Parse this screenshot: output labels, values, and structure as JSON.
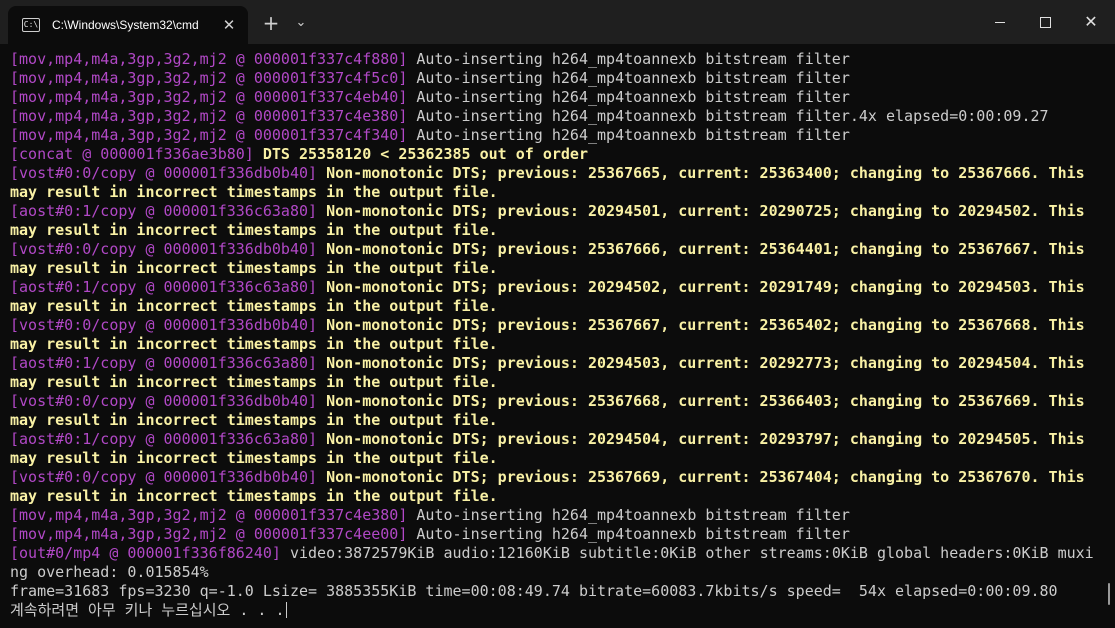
{
  "window": {
    "tab_title": "C:\\Windows\\System32\\cmd",
    "tab_icon_glyph": "C:\\",
    "close_tab_glyph": "✕",
    "new_tab_glyph": "+",
    "dropdown_glyph": "⌄",
    "close_window_glyph": "✕"
  },
  "colors": {
    "background": "#0c0c0c",
    "titlebar": "#1f1f1f",
    "default_text": "#cccccc",
    "log_prefix": "#b148c6",
    "warning_text": "#f9f1a5"
  },
  "terminal": {
    "lines": [
      {
        "prefix": "[mov,mp4,m4a,3gp,3g2,mj2 @ 000001f337c4f880]",
        "text": " Auto-inserting h264_mp4toannexb bitstream filter",
        "style": "gray"
      },
      {
        "prefix": "[mov,mp4,m4a,3gp,3g2,mj2 @ 000001f337c4f5c0]",
        "text": " Auto-inserting h264_mp4toannexb bitstream filter",
        "style": "gray"
      },
      {
        "prefix": "[mov,mp4,m4a,3gp,3g2,mj2 @ 000001f337c4eb40]",
        "text": " Auto-inserting h264_mp4toannexb bitstream filter",
        "style": "gray"
      },
      {
        "prefix": "[mov,mp4,m4a,3gp,3g2,mj2 @ 000001f337c4e380]",
        "text": " Auto-inserting h264_mp4toannexb bitstream filter.4x elapsed=0:00:09.27",
        "style": "gray"
      },
      {
        "prefix": "[mov,mp4,m4a,3gp,3g2,mj2 @ 000001f337c4f340]",
        "text": " Auto-inserting h264_mp4toannexb bitstream filter",
        "style": "gray"
      },
      {
        "prefix": "[concat @ 000001f336ae3b80]",
        "text": " DTS 25358120 < 25362385 out of order",
        "style": "yellow"
      },
      {
        "prefix": "[vost#0:0/copy @ 000001f336db0b40]",
        "text": " Non-monotonic DTS; previous: 25367665, current: 25363400; changing to 25367666. This",
        "style": "yellow"
      },
      {
        "prefix": "",
        "text": "may result in incorrect timestamps in the output file.",
        "style": "yellow"
      },
      {
        "prefix": "[aost#0:1/copy @ 000001f336c63a80]",
        "text": " Non-monotonic DTS; previous: 20294501, current: 20290725; changing to 20294502. This",
        "style": "yellow"
      },
      {
        "prefix": "",
        "text": "may result in incorrect timestamps in the output file.",
        "style": "yellow"
      },
      {
        "prefix": "[vost#0:0/copy @ 000001f336db0b40]",
        "text": " Non-monotonic DTS; previous: 25367666, current: 25364401; changing to 25367667. This",
        "style": "yellow"
      },
      {
        "prefix": "",
        "text": "may result in incorrect timestamps in the output file.",
        "style": "yellow"
      },
      {
        "prefix": "[aost#0:1/copy @ 000001f336c63a80]",
        "text": " Non-monotonic DTS; previous: 20294502, current: 20291749; changing to 20294503. This",
        "style": "yellow"
      },
      {
        "prefix": "",
        "text": "may result in incorrect timestamps in the output file.",
        "style": "yellow"
      },
      {
        "prefix": "[vost#0:0/copy @ 000001f336db0b40]",
        "text": " Non-monotonic DTS; previous: 25367667, current: 25365402; changing to 25367668. This",
        "style": "yellow"
      },
      {
        "prefix": "",
        "text": "may result in incorrect timestamps in the output file.",
        "style": "yellow"
      },
      {
        "prefix": "[aost#0:1/copy @ 000001f336c63a80]",
        "text": " Non-monotonic DTS; previous: 20294503, current: 20292773; changing to 20294504. This",
        "style": "yellow"
      },
      {
        "prefix": "",
        "text": "may result in incorrect timestamps in the output file.",
        "style": "yellow"
      },
      {
        "prefix": "[vost#0:0/copy @ 000001f336db0b40]",
        "text": " Non-monotonic DTS; previous: 25367668, current: 25366403; changing to 25367669. This",
        "style": "yellow"
      },
      {
        "prefix": "",
        "text": "may result in incorrect timestamps in the output file.",
        "style": "yellow"
      },
      {
        "prefix": "[aost#0:1/copy @ 000001f336c63a80]",
        "text": " Non-monotonic DTS; previous: 20294504, current: 20293797; changing to 20294505. This",
        "style": "yellow"
      },
      {
        "prefix": "",
        "text": "may result in incorrect timestamps in the output file.",
        "style": "yellow"
      },
      {
        "prefix": "[vost#0:0/copy @ 000001f336db0b40]",
        "text": " Non-monotonic DTS; previous: 25367669, current: 25367404; changing to 25367670. This",
        "style": "yellow"
      },
      {
        "prefix": "",
        "text": "may result in incorrect timestamps in the output file.",
        "style": "yellow"
      },
      {
        "prefix": "[mov,mp4,m4a,3gp,3g2,mj2 @ 000001f337c4e380]",
        "text": " Auto-inserting h264_mp4toannexb bitstream filter",
        "style": "gray"
      },
      {
        "prefix": "[mov,mp4,m4a,3gp,3g2,mj2 @ 000001f337c4ee00]",
        "text": " Auto-inserting h264_mp4toannexb bitstream filter",
        "style": "gray"
      },
      {
        "prefix": "[out#0/mp4 @ 000001f336f86240]",
        "text": " video:3872579KiB audio:12160KiB subtitle:0KiB other streams:0KiB global headers:0KiB muxi",
        "style": "gray"
      },
      {
        "prefix": "",
        "text": "ng overhead: 0.015854%",
        "style": "gray"
      },
      {
        "prefix": "",
        "text": "frame=31683 fps=3230 q=-1.0 Lsize= 3885355KiB time=00:08:49.74 bitrate=60083.7kbits/s speed=  54x elapsed=0:00:09.80",
        "style": "gray"
      }
    ],
    "prompt": "계속하려면 아무 키나 누르십시오 . . ."
  }
}
